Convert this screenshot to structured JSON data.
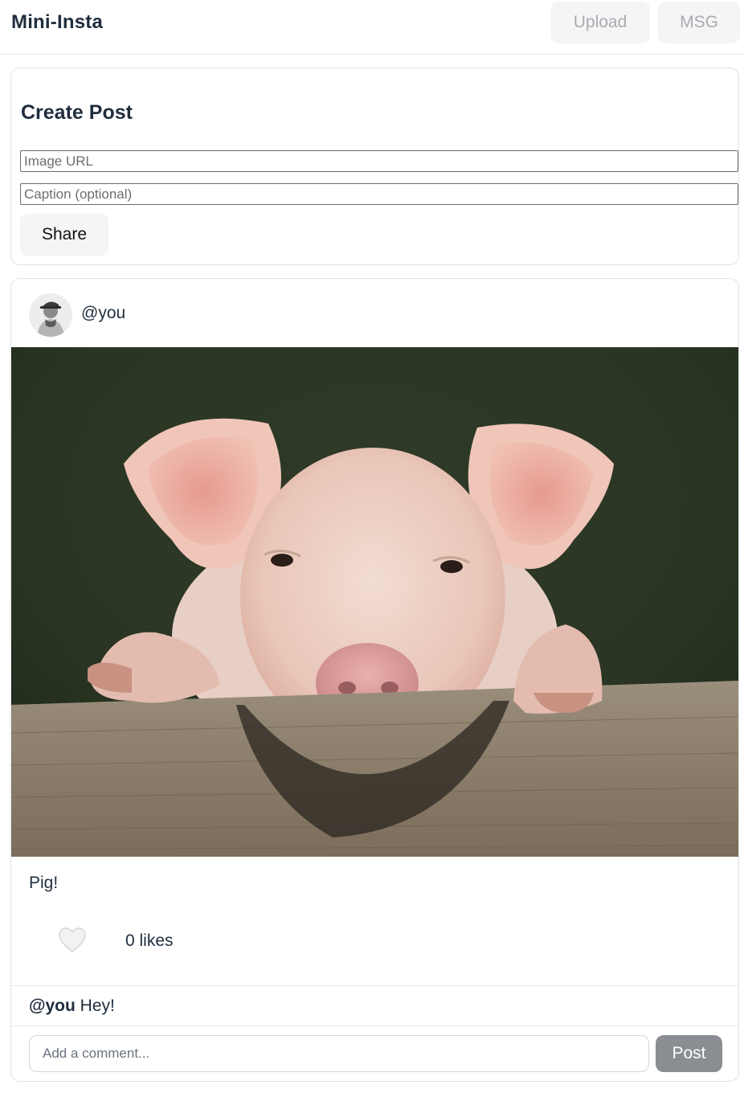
{
  "header": {
    "brand": "Mini-Insta",
    "upload_label": "Upload",
    "msg_label": "MSG"
  },
  "create_post": {
    "title": "Create Post",
    "image_url_placeholder": "Image URL",
    "image_url_value": "",
    "caption_placeholder": "Caption (optional)",
    "caption_value": "",
    "share_label": "Share"
  },
  "post": {
    "username": "@you",
    "avatar_icon": "user-avatar-icon",
    "image_subject": "pig",
    "caption": "Pig!",
    "like_icon": "heart-icon",
    "likes_text": "0 likes",
    "comments": [
      {
        "user": "@you",
        "text": "Hey!"
      }
    ],
    "comment_placeholder": "Add a comment...",
    "comment_value": "",
    "post_label": "Post"
  },
  "colors": {
    "brand_text": "#1f2d3d",
    "button_bg": "#f5f5f5",
    "disabled_text": "#a7abb2",
    "post_button_bg": "#8a8d92",
    "border": "#dfe2e6"
  }
}
